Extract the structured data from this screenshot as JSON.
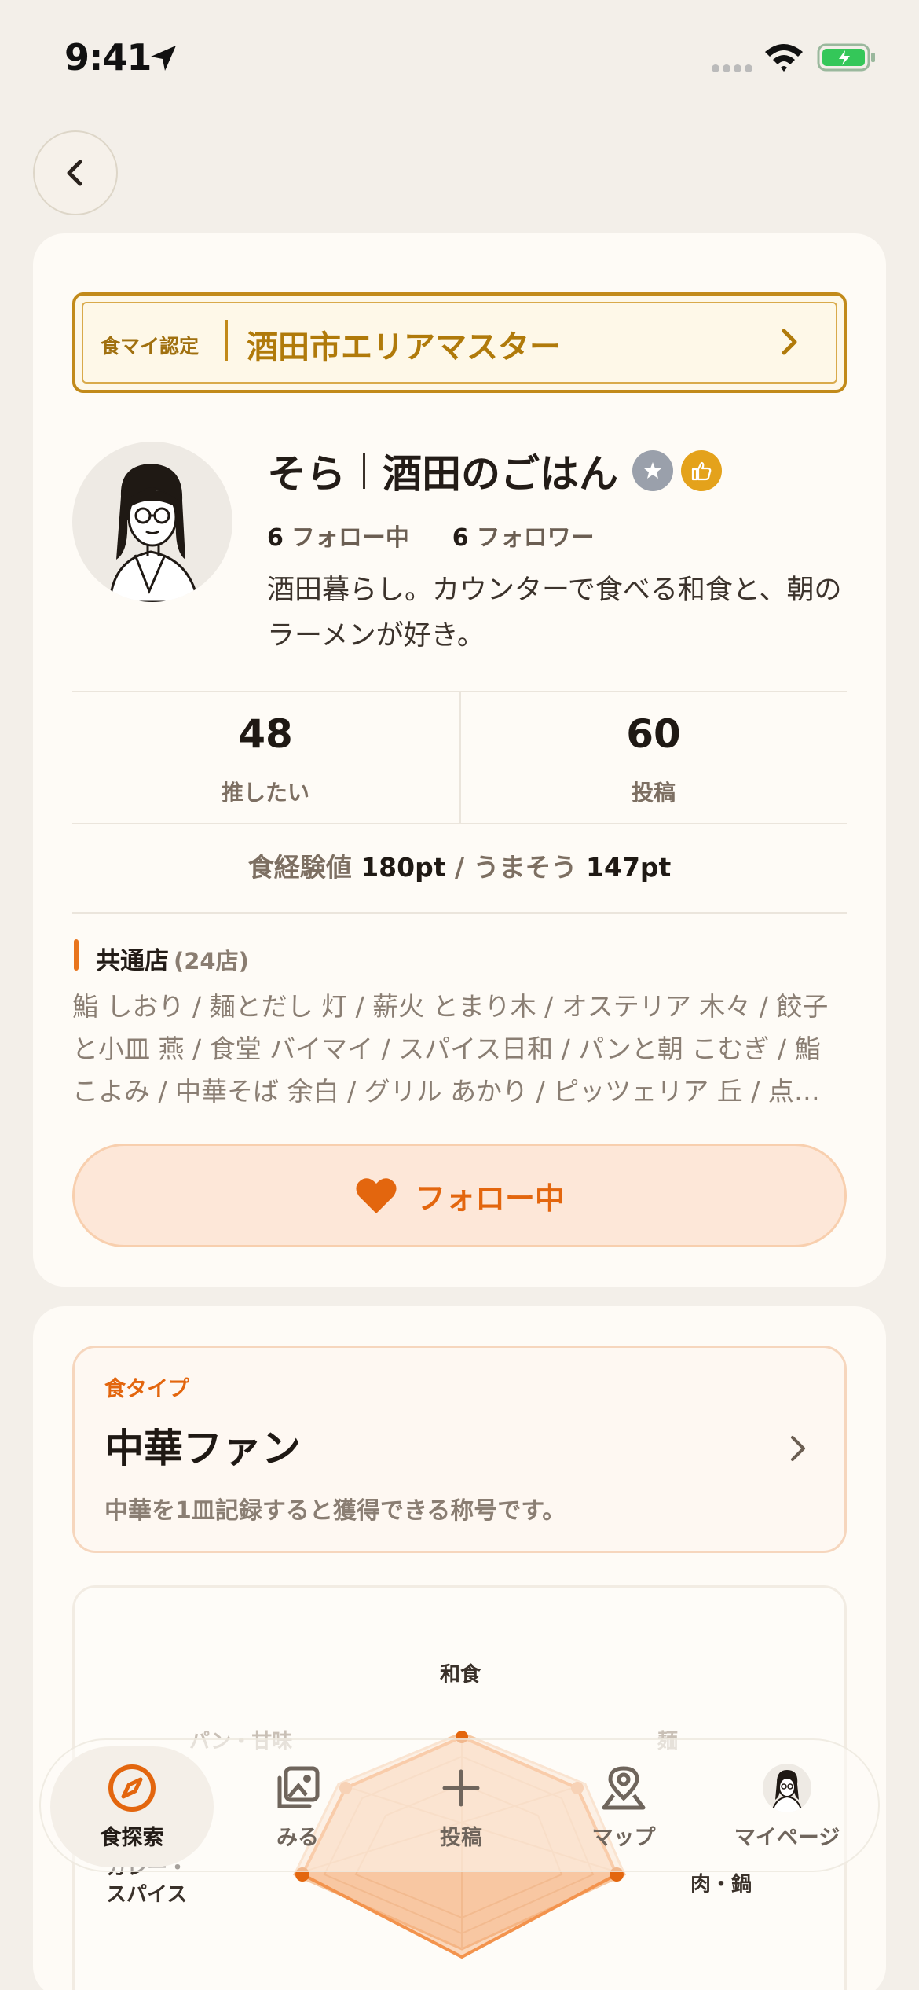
{
  "status_bar": {
    "time": "9:41"
  },
  "badge": {
    "label": "食マイ認定",
    "title": "酒田市エリアマスター"
  },
  "profile": {
    "name_primary": "そら",
    "name_secondary": "酒田のごはん",
    "following_count": "6",
    "following_label": "フォロー中",
    "followers_count": "6",
    "followers_label": "フォロワー",
    "bio": "酒田暮らし。カウンターで食べる和食と、朝のラーメンが好き。"
  },
  "stats": [
    {
      "value": "48",
      "label": "推したい"
    },
    {
      "value": "60",
      "label": "投稿"
    }
  ],
  "points": {
    "exp_label": "食経験値",
    "exp_value": "180pt",
    "separator": "/",
    "umaso_label": "うまそう",
    "umaso_value": "147pt"
  },
  "common_shops": {
    "title": "共通店",
    "count": "(24店)",
    "list": "鮨 しおり / 麺とだし 灯 / 薪火 とまり木 / オステリア 木々 / 餃子と小皿 燕 / 食堂 バイマイ / スパイス日和 / パンと朝 こむぎ / 鮨 こよみ / 中華そば 余白 / グリル あかり / ピッツェリア 丘 / 点…"
  },
  "follow_button": {
    "label": "フォロー中"
  },
  "food_type": {
    "label": "食タイプ",
    "title": "中華ファン",
    "description": "中華を1皿記録すると獲得できる称号です。"
  },
  "radar": {
    "labels": [
      "和食",
      "麺",
      "肉・鍋",
      "カレー・スパイス",
      "パン・甘味"
    ]
  },
  "nav": [
    {
      "label": "食探索",
      "icon": "compass-icon"
    },
    {
      "label": "みる",
      "icon": "gallery-icon"
    },
    {
      "label": "投稿",
      "icon": "plus-icon"
    },
    {
      "label": "マップ",
      "icon": "map-pin-icon"
    },
    {
      "label": "マイページ",
      "icon": "avatar-icon"
    }
  ],
  "colors": {
    "accent": "#e3660e",
    "gold": "#b07a0a",
    "background": "#f3efe9"
  }
}
